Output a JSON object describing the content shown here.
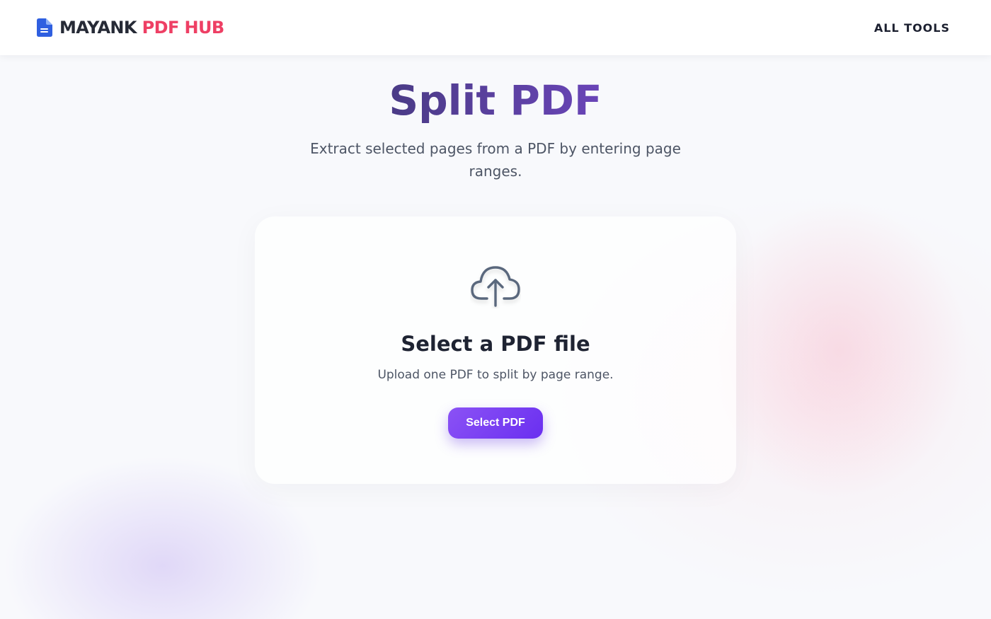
{
  "navbar": {
    "brand_main": "MAYANK",
    "brand_accent": "PDF HUB",
    "nav_link": "ALL TOOLS",
    "logo_icon": "file-text-icon"
  },
  "hero": {
    "title": "Split PDF",
    "subtitle": "Extract selected pages from a PDF by entering page ranges."
  },
  "upload": {
    "icon": "cloud-upload-icon",
    "title": "Select a PDF file",
    "subtitle": "Upload one PDF to split by page range.",
    "button_label": "Select PDF"
  },
  "colors": {
    "brand_blue": "#2f5fe0",
    "brand_accent": "#ee3f64",
    "title_gradient_start": "#4a3b86",
    "title_gradient_end": "#6a45b8",
    "button_gradient_start": "#8b52f5",
    "button_gradient_end": "#6a2ff0"
  }
}
